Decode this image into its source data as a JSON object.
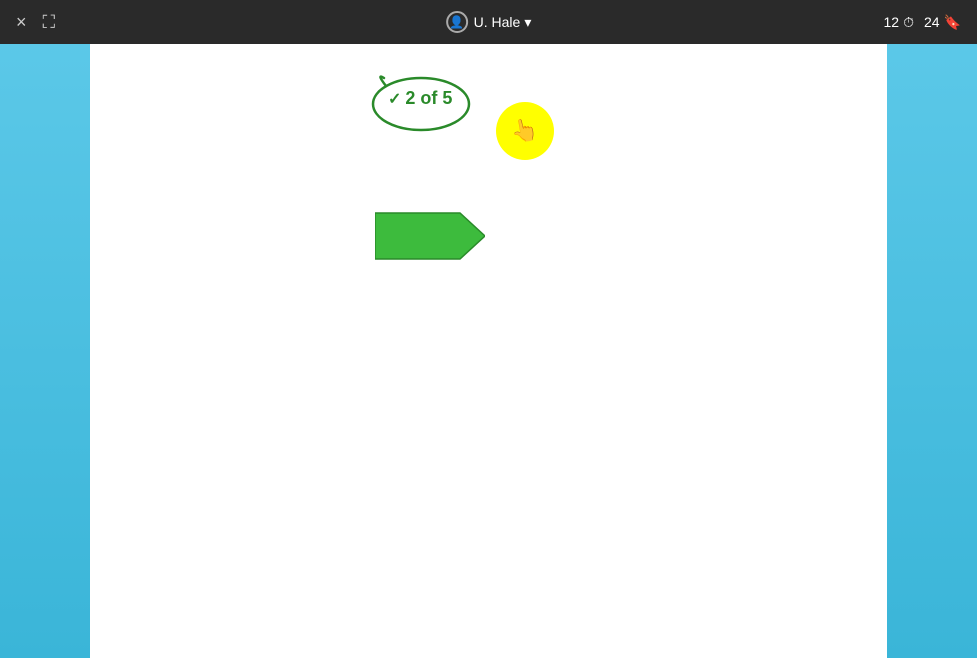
{
  "topbar": {
    "close_label": "×",
    "expand_label": "⛶",
    "user_icon": "👤",
    "user_name": "U. Hale",
    "dropdown_arrow": "▾",
    "stat1_value": "12",
    "stat1_icon": "⏱",
    "stat2_value": "24",
    "stat2_icon": "🔖"
  },
  "badge": {
    "checkmark": "✓",
    "text": "2 of 5"
  },
  "cursor": {
    "symbol": "👆"
  }
}
